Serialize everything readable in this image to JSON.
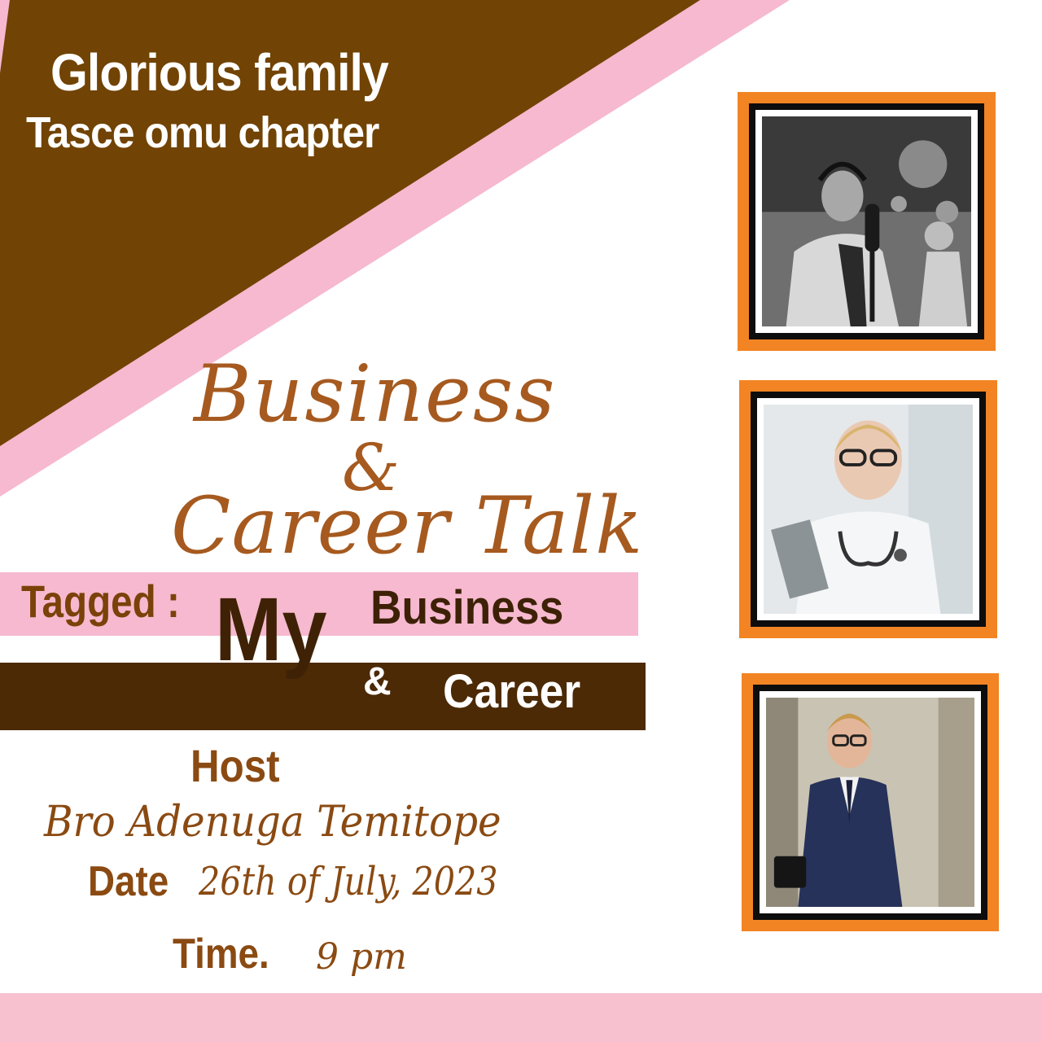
{
  "header": {
    "line1": "Glorious family",
    "line2": "Tasce omu chapter"
  },
  "title": {
    "business": "Business",
    "amp": "&",
    "career_talk": "Career Talk"
  },
  "tagline": {
    "label": "Tagged :",
    "my": "My",
    "business": "Business",
    "amp": "&",
    "career": "Career"
  },
  "host": {
    "label": "Host",
    "name": "Bro Adenuga Temitope"
  },
  "date": {
    "label": "Date",
    "value": "26th of July, 2023"
  },
  "time": {
    "label": "Time.",
    "value": "9 pm"
  },
  "colors": {
    "brown": "#714304",
    "pink": "#f6b9cf",
    "dark_brown": "#4c2a06",
    "orange": "#f28423",
    "script_brown": "#a65a1f"
  },
  "photos": [
    {
      "icon": "podcaster-photo"
    },
    {
      "icon": "doctor-photo"
    },
    {
      "icon": "businessman-photo"
    }
  ]
}
